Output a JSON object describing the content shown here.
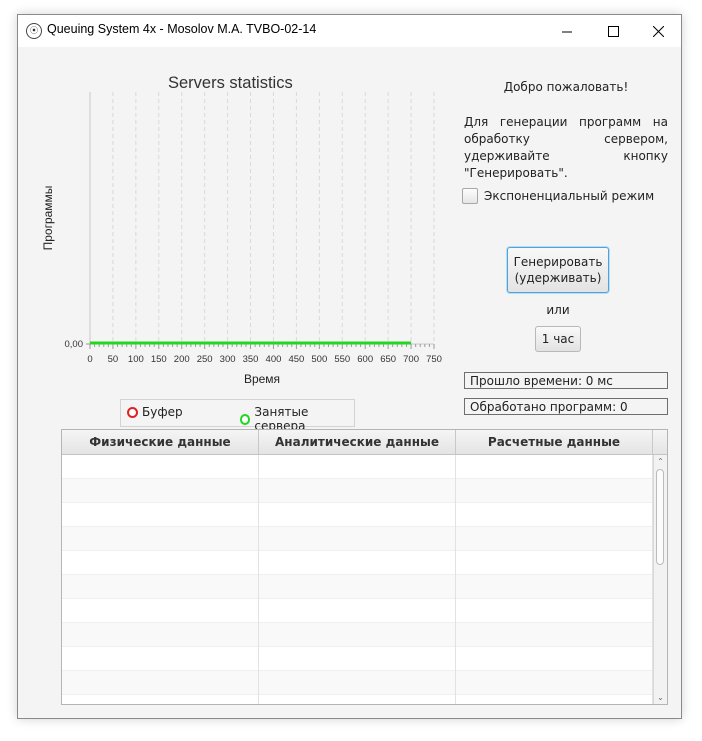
{
  "window": {
    "title": "Queuing System 4x - Mosolov M.A. TVBO-02-14",
    "icon": "app-logo-icon"
  },
  "chart_data": {
    "type": "line",
    "title": "Servers statistics",
    "xlabel": "Время",
    "ylabel": "Программы",
    "x_ticks": [
      "0",
      "50",
      "100",
      "150",
      "200",
      "250",
      "300",
      "350",
      "400",
      "450",
      "500",
      "550",
      "600",
      "650",
      "700",
      "750"
    ],
    "y_ticks": [
      "0,00"
    ],
    "xlim": [
      0,
      750
    ],
    "ylim": [
      0,
      1
    ],
    "grid": true,
    "legend_position": "bottom",
    "series": [
      {
        "name": "Буфер",
        "color": "#e02020",
        "x": [
          0,
          700
        ],
        "y": [
          0,
          0
        ]
      },
      {
        "name": "Занятые сервера",
        "color": "#22d622",
        "x": [
          0,
          700
        ],
        "y": [
          0,
          0
        ]
      }
    ]
  },
  "panel": {
    "welcome": "Добро пожаловать!",
    "hint": "Для генерации программ на обработку сервером, удерживайте кнопку \"Генерировать\".",
    "exponential_label": "Экспоненциальный режим",
    "exponential_checked": false,
    "generate_label_line1": "Генерировать",
    "generate_label_line2": "(удерживать)",
    "or_label": "или",
    "hour_button": "1 час",
    "elapsed": "Прошло времени: 0 мс",
    "processed": "Обработано программ: 0"
  },
  "table": {
    "columns": [
      "Физические данные",
      "Аналитические данные",
      "Расчетные данные"
    ],
    "rows": []
  }
}
